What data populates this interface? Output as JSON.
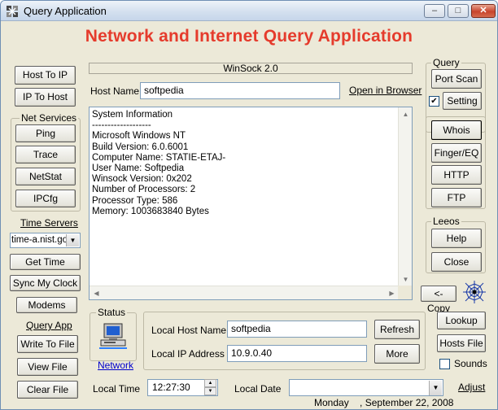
{
  "window": {
    "title": "Query Application"
  },
  "headline": "Network and Internet Query Application",
  "left": {
    "host_to_ip": "Host To IP",
    "ip_to_host": "IP To Host",
    "net_services_label": "Net Services",
    "ping": "Ping",
    "trace": "Trace",
    "netstat": "NetStat",
    "ipcfg": "IPCfg",
    "time_servers_link": "Time Servers",
    "time_server_selected": "time-a.nist.gov",
    "get_time": "Get Time",
    "sync_clock": "Sync My Clock",
    "modems": "Modems",
    "query_app_link": "Query App",
    "write_to_file": "Write To File",
    "view_file": "View File",
    "clear_file": "Clear File"
  },
  "center": {
    "winsock": "WinSock 2.0",
    "host_name_label": "Host Name",
    "host_name_value": "softpedia",
    "open_in_browser": "Open in Browser",
    "memo_text": "System Information\n-------------------\nMicrosoft Windows NT\nBuild Version: 6.0.6001\nComputer Name: STATIE-ETAJ-\nUser Name: Softpedia\nWinsock Version: 0x202\nNumber of Processors: 2\nProcessor Type: 586\nMemory: 1003683840 Bytes",
    "status_label": "Status",
    "network_link": "Network",
    "local_host_name_label": "Local Host Name",
    "local_host_name_value": "softpedia",
    "local_ip_label": "Local IP Address",
    "local_ip_value": "10.9.0.40",
    "refresh": "Refresh",
    "more": "More",
    "local_time_label": "Local Time",
    "local_time_value": "12:27:30",
    "local_date_label": "Local Date",
    "local_date_value": "Monday    , September 22, 2008"
  },
  "right": {
    "query_label": "Query",
    "port_scan": "Port Scan",
    "setting": "Setting",
    "setting_checked": true,
    "whois": "Whois",
    "finger": "Finger/EQ",
    "http": "HTTP",
    "ftp": "FTP",
    "leeos_label": "Leeos",
    "help": "Help",
    "close": "Close",
    "copy": "<- Copy",
    "lookup": "Lookup",
    "hosts_file": "Hosts File",
    "sounds": "Sounds",
    "adjust": "Adjust"
  },
  "icons": {
    "app": "app-icon",
    "computer": "computer-icon",
    "spider": "spider-web-icon"
  },
  "colors": {
    "headline": "#e53b2c",
    "link": "#0000cc"
  }
}
